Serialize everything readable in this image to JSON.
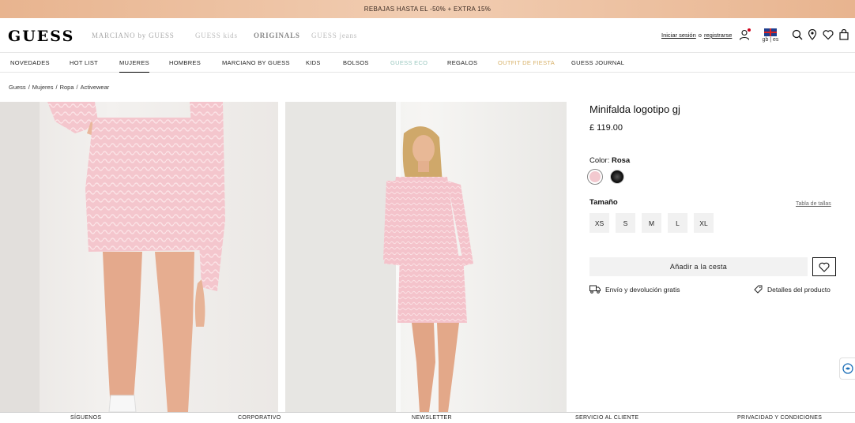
{
  "promo_bar": {
    "text": "REBAJAS HASTA EL -50% + EXTRA 15%"
  },
  "header": {
    "logo": "GUESS",
    "brands": [
      "MARCIANO by GUESS",
      "GUESS kids",
      "ORIGINALS",
      "GUESS jeans"
    ],
    "login": "Iniciar sesión",
    "or": "o",
    "register": "registrarse",
    "lang": "gb | es"
  },
  "nav": {
    "items": [
      "NOVEDADES",
      "HOT LIST",
      "MUJERES",
      "HOMBRES",
      "MARCIANO BY GUESS",
      "KIDS",
      "BOLSOS",
      "GUESS ECO",
      "REGALOS",
      "OUTFIT DE FIESTA",
      "GUESS JOURNAL"
    ],
    "active": "MUJERES"
  },
  "breadcrumb": [
    "Guess",
    "Mujeres",
    "Ropa",
    "Activewear"
  ],
  "product": {
    "title": "Minifalda logotipo gj",
    "price": "£ 119.00",
    "color_label": "Color:",
    "color_value": "Rosa",
    "colors": [
      "#f2c9cf",
      "#1a1a1a"
    ],
    "size_label": "Tamaño",
    "size_chart": "Tabla de tallas",
    "sizes": [
      "XS",
      "S",
      "M",
      "L",
      "XL"
    ],
    "add_to_cart": "Añadir a la cesta",
    "shipping": "Envío y devolución gratis",
    "details": "Detalles del producto"
  },
  "footer": [
    "SÍGUENOS",
    "CORPORATIVO",
    "NEWSLETTER",
    "SERVICIO AL CLIENTE",
    "PRIVACIDAD Y CONDICIONES"
  ]
}
